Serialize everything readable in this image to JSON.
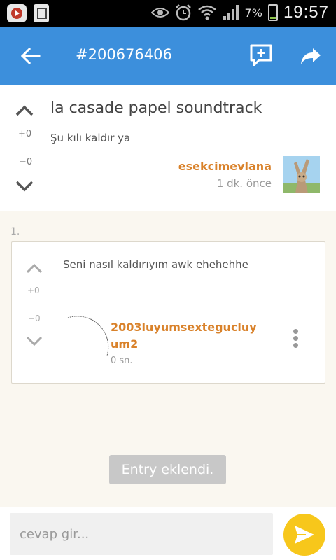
{
  "status_bar": {
    "battery_percent": "7%",
    "time": "19:57",
    "icons": [
      "youtube-icon",
      "sim-card-icon",
      "eye-icon",
      "alarm-icon",
      "wifi-icon",
      "signal-icon",
      "battery-charging-icon"
    ]
  },
  "app_bar": {
    "title": "#200676406",
    "background": "#3c8fdc"
  },
  "topic": {
    "title": "la casade papel soundtrack",
    "text": "Şu kılı kaldır ya",
    "upvotes": "+0",
    "downvotes": "−0",
    "author": "esekcimevlana",
    "time": "1 dk. önce"
  },
  "entry": {
    "index": "1.",
    "text": "Seni nasıl kaldırıyım awk ehehehhe",
    "upvotes": "+0",
    "downvotes": "−0",
    "author": "2003luyumsextegucluyum2",
    "time": "0 sn."
  },
  "toast": {
    "message": "Entry eklendi."
  },
  "reply": {
    "placeholder": "cevap gir...",
    "value": ""
  },
  "colors": {
    "accent": "#3c8fdc",
    "username": "#d9822b",
    "send_button": "#f7c71b"
  }
}
